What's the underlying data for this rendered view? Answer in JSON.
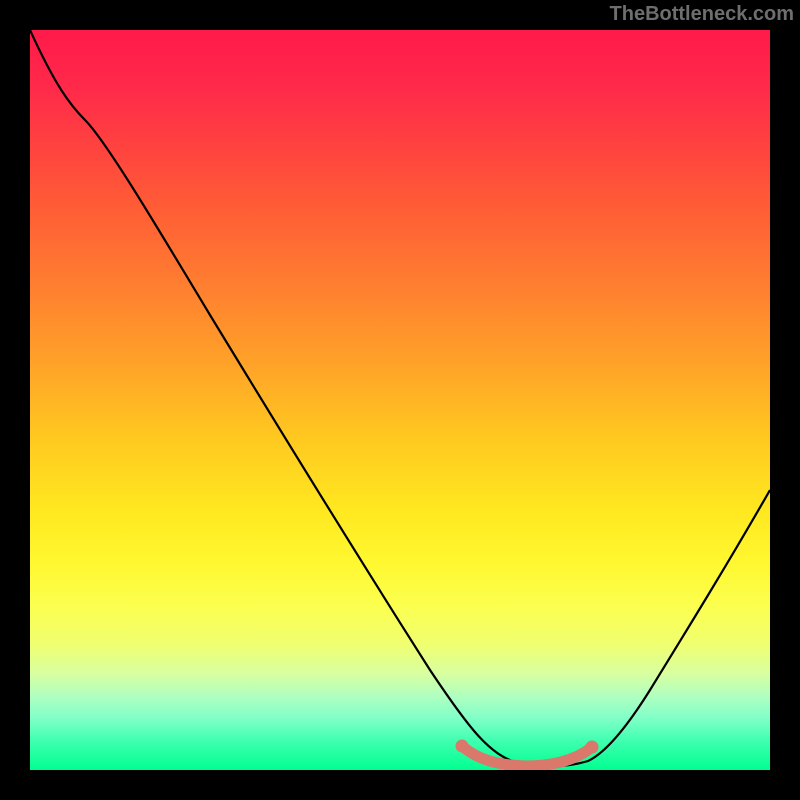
{
  "watermark": "TheBottleneck.com",
  "chart_data": {
    "type": "line",
    "title": "",
    "xlabel": "",
    "ylabel": "",
    "xlim": [
      0,
      100
    ],
    "ylim": [
      0,
      100
    ],
    "gradient": {
      "top_color": "#ff1a4a",
      "bottom_color": "#00ff90",
      "meaning": "red high to green low"
    },
    "series": [
      {
        "name": "bottleneck-curve",
        "color": "#000000",
        "x": [
          0,
          5,
          10,
          15,
          20,
          25,
          30,
          35,
          40,
          45,
          50,
          55,
          58,
          62,
          66,
          70,
          73,
          76,
          80,
          85,
          90,
          95,
          100
        ],
        "y": [
          100,
          94,
          88,
          80,
          72,
          64,
          56,
          48,
          40,
          32,
          24,
          16,
          10,
          5,
          2,
          1,
          1,
          2,
          6,
          14,
          24,
          35,
          46
        ]
      },
      {
        "name": "optimal-range-marker",
        "color": "#d9786b",
        "type": "segment",
        "x": [
          58,
          60,
          64,
          68,
          72,
          75,
          77
        ],
        "y": [
          4,
          2.5,
          1.5,
          1,
          1.5,
          2.5,
          4
        ]
      }
    ],
    "annotations": []
  }
}
